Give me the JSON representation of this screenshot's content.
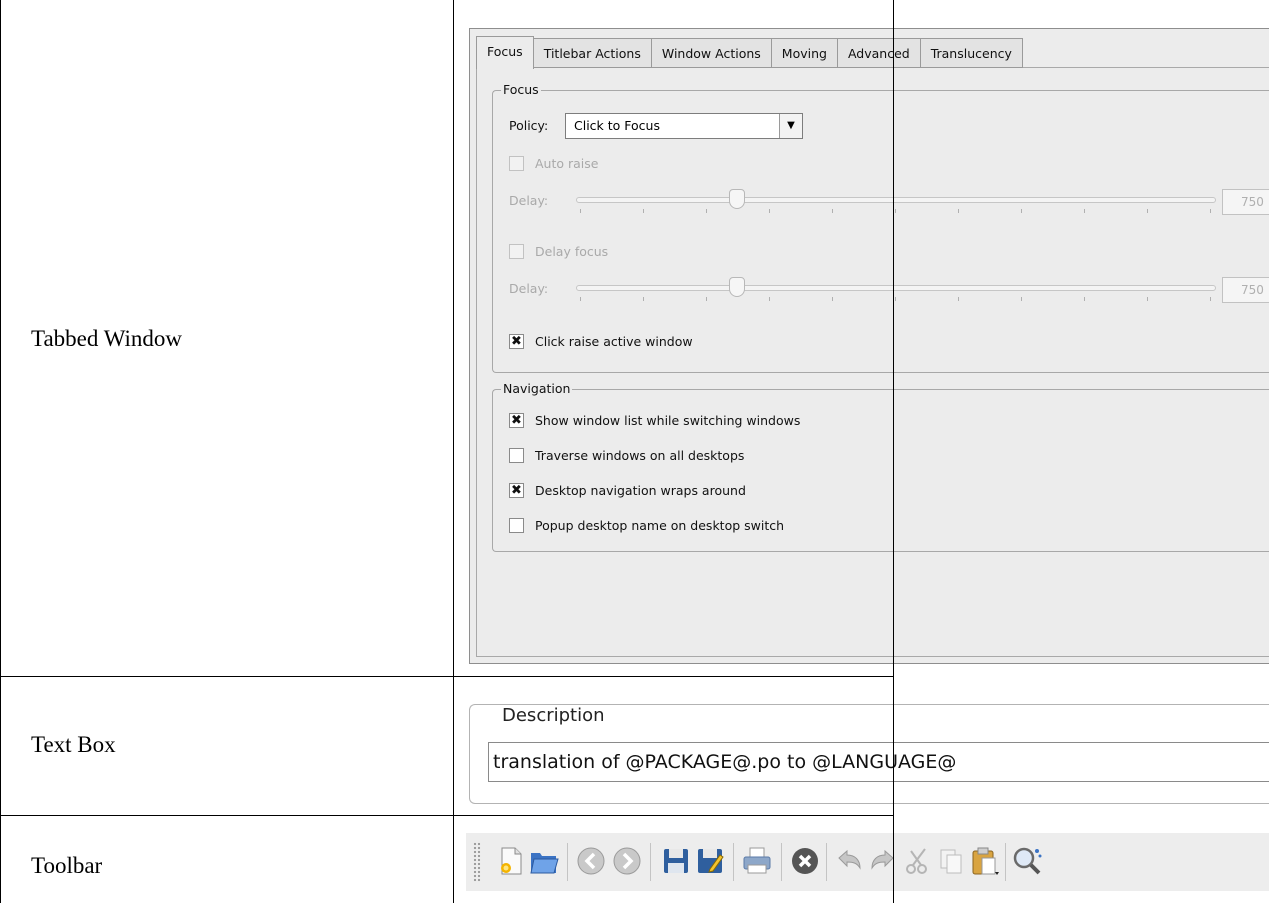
{
  "rows": {
    "tabbed_window": "Tabbed Window",
    "text_box": "Text Box",
    "toolbar": "Toolbar"
  },
  "tabs": [
    "Focus",
    "Titlebar Actions",
    "Window Actions",
    "Moving",
    "Advanced",
    "Translucency"
  ],
  "focus_group": {
    "title": "Focus",
    "policy_label": "Policy:",
    "policy_value": "Click to Focus",
    "auto_raise": "Auto raise",
    "delay1_label": "Delay:",
    "delay1_value": "750",
    "delay1_level": 0.25,
    "delay_focus": "Delay focus",
    "delay2_label": "Delay:",
    "delay2_value": "750",
    "delay2_level": 0.25,
    "click_raise": "Click raise active window",
    "click_raise_checked": true
  },
  "navigation_group": {
    "title": "Navigation",
    "items": [
      {
        "label": "Show window list while switching windows",
        "checked": true
      },
      {
        "label": "Traverse windows on all desktops",
        "checked": false
      },
      {
        "label": "Desktop navigation wraps around",
        "checked": true
      },
      {
        "label": "Popup desktop name on desktop switch",
        "checked": false
      }
    ]
  },
  "description": {
    "title": "Description",
    "value": "translation of @PACKAGE@.po to @LANGUAGE@"
  },
  "toolbar_icons": [
    "new-document-icon",
    "open-folder-icon",
    "back-icon",
    "forward-icon",
    "save-icon",
    "save-as-icon",
    "print-icon",
    "stop-icon",
    "undo-icon",
    "redo-icon",
    "cut-icon",
    "copy-icon",
    "paste-icon",
    "find-icon"
  ],
  "colors": {
    "frame": "#000000",
    "panel": "#ececec",
    "accent": "#3b73c4"
  }
}
